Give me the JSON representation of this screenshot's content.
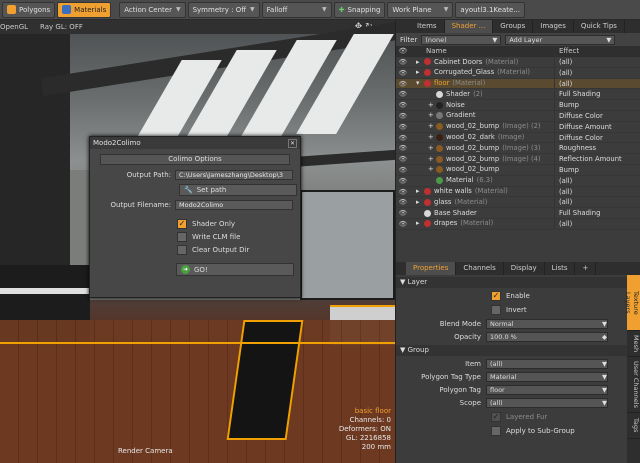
{
  "toolbar": {
    "polygons": "Polygons",
    "materials": "Materials",
    "action_center": "Action Center",
    "symmetry": "Symmetry : Off",
    "falloff": "Falloff",
    "snapping": "Snapping",
    "work_plane": "Work Plane",
    "layout": "ayoutl3.1Keate..."
  },
  "viewport": {
    "opengl": "OpenGL",
    "raygl": "Ray GL: OFF",
    "render_camera": "Render Camera",
    "info": {
      "material": "basic floor",
      "channels": "Channels: 0",
      "deformers": "Deformers: ON",
      "gl": "GL: 2216858",
      "distance": "200 mm"
    }
  },
  "dialog": {
    "title": "Modo2Colimo",
    "options_tab": "Colimo Options",
    "output_path_label": "Output Path:",
    "output_path_value": "C:\\Users\\Jameszhang\\Desktop\\3",
    "set_path": "Set path",
    "output_filename_label": "Output Filename:",
    "output_filename_value": "Modo2Colimo",
    "shader_only": "Shader Only",
    "write_clm": "Write CLM file",
    "clear_output": "Clear Output Dir",
    "go": "GO!"
  },
  "shader_panel": {
    "tabs": [
      "Items",
      "Shader ...",
      "Groups",
      "Images",
      "Quick Tips"
    ],
    "filter_label": "Filter",
    "filter_value": "(none)",
    "add_layer": "Add Layer",
    "col_name": "Name",
    "col_effect": "Effect",
    "rows": [
      {
        "name": "Cabinet Doors",
        "tag": "(Material)",
        "effect": "(all)",
        "color": "#c03030"
      },
      {
        "name": "Corrugated_Glass",
        "tag": "(Material)",
        "effect": "(all)",
        "color": "#c03030"
      },
      {
        "name": "floor",
        "tag": "(Material)",
        "effect": "(all)",
        "color": "#c03030"
      },
      {
        "name": "Shader",
        "tag": "(2)",
        "effect": "Full Shading",
        "color": "#d8d8d8"
      },
      {
        "name": "Noise",
        "tag": "",
        "effect": "Bump",
        "color": "#222222"
      },
      {
        "name": "Gradient",
        "tag": "",
        "effect": "Diffuse Color",
        "color": "#777777"
      },
      {
        "name": "wood_02_bump",
        "tag": "(Image) (2)",
        "effect": "Diffuse Amount",
        "color": "#8a5a20"
      },
      {
        "name": "wood_02_dark",
        "tag": "(Image)",
        "effect": "Diffuse Color",
        "color": "#3a2010"
      },
      {
        "name": "wood_02_bump",
        "tag": "(Image) (3)",
        "effect": "Roughness",
        "color": "#8a5a20"
      },
      {
        "name": "wood_02_bump",
        "tag": "(Image) (4)",
        "effect": "Reflection Amount",
        "color": "#8a5a20"
      },
      {
        "name": "wood_02_bump",
        "tag": "",
        "effect": "Bump",
        "color": "#8a5a20"
      },
      {
        "name": "Material",
        "tag": "(6.3)",
        "effect": "(all)",
        "color": "#4a9a4a"
      },
      {
        "name": "white walls",
        "tag": "(Material)",
        "effect": "(all)",
        "color": "#c03030"
      },
      {
        "name": "glass",
        "tag": "(Material)",
        "effect": "(all)",
        "color": "#c03030"
      },
      {
        "name": "Base Shader",
        "tag": "",
        "effect": "Full Shading",
        "color": "#d8d8d8"
      },
      {
        "name": "drapes",
        "tag": "(Material)",
        "effect": "(all)",
        "color": "#c03030"
      }
    ]
  },
  "properties": {
    "tabs": [
      "Properties",
      "Channels",
      "Display",
      "Lists"
    ],
    "layer_section": "Layer",
    "enable": "Enable",
    "invert": "Invert",
    "blend_mode_label": "Blend Mode",
    "blend_mode_value": "Normal",
    "opacity_label": "Opacity",
    "opacity_value": "100.0 %",
    "group_section": "Group",
    "item_label": "Item",
    "item_value": "(all)",
    "ptag_type_label": "Polygon Tag Type",
    "ptag_type_value": "Material",
    "ptag_label": "Polygon Tag",
    "ptag_value": "floor",
    "scope_label": "Scope",
    "scope_value": "(all)",
    "layered_fur": "Layered Fur",
    "apply_subgroup": "Apply to Sub-Group",
    "vertical_tabs": [
      "Texture Layers",
      "Mesh",
      "User Channels",
      "Tags"
    ]
  }
}
